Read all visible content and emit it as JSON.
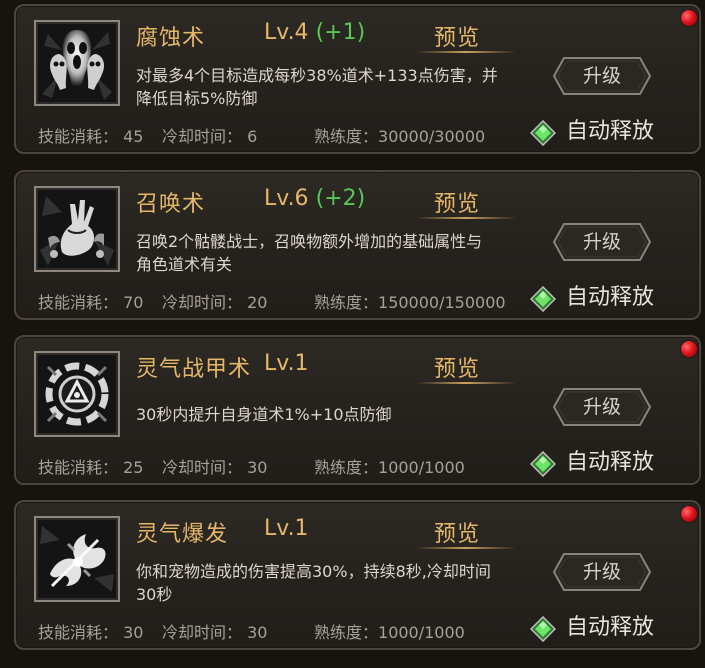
{
  "labels": {
    "preview": "预览",
    "cost": "技能消耗：",
    "cooldown": "冷却时间：",
    "mastery": "熟练度：",
    "upgrade": "升级",
    "auto_release": "自动释放"
  },
  "colors": {
    "gold_text": "#e5b767",
    "green_bonus": "#58c755",
    "notice_dot": "#e1141c",
    "panel_border": "#4e463d"
  },
  "skills": [
    {
      "name": "腐蚀术",
      "level": "Lv.4",
      "level_bonus": "(+1)",
      "desc_line1": "对最多4个目标造成每秒38%道术+133点伤害，并",
      "desc_line2": "降低目标5%防御",
      "cost": "45",
      "cooldown": "6",
      "mastery": "30000/30000",
      "icon": "ghost-skulls-icon",
      "has_notice_dot": true
    },
    {
      "name": "召唤术",
      "level": "Lv.6",
      "level_bonus": "(+2)",
      "desc_line1": "召唤2个骷髅战士，召唤物额外增加的基础属性与",
      "desc_line2": "角色道术有关",
      "cost": "70",
      "cooldown": "20",
      "mastery": "150000/150000",
      "icon": "summon-claw-icon",
      "has_notice_dot": false
    },
    {
      "name": "灵气战甲术",
      "level": "Lv.1",
      "level_bonus": "",
      "desc_line1": "30秒内提升自身道术1%+10点防御",
      "desc_line2": "",
      "cost": "25",
      "cooldown": "30",
      "mastery": "1000/1000",
      "icon": "spirit-armor-icon",
      "has_notice_dot": true
    },
    {
      "name": "灵气爆发",
      "level": "Lv.1",
      "level_bonus": "",
      "desc_line1": "你和宠物造成的伤害提高30%，持续8秒,冷却时间",
      "desc_line2": "30秒",
      "cost": "30",
      "cooldown": "30",
      "mastery": "1000/1000",
      "icon": "spirit-burst-icon",
      "has_notice_dot": true
    }
  ]
}
